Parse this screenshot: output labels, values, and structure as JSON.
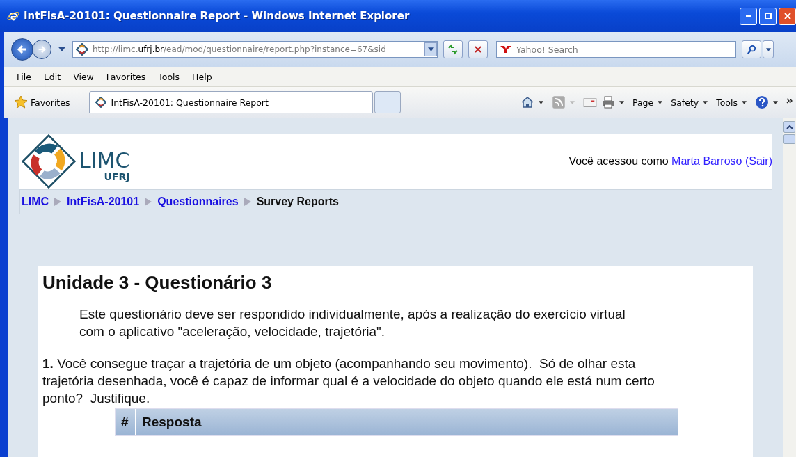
{
  "window": {
    "title": "IntFisA-20101: Questionnaire Report - Windows Internet Explorer"
  },
  "address_bar": {
    "segments": [
      {
        "text": "http://limc.",
        "emphasis": false
      },
      {
        "text": "ufrj.br",
        "emphasis": true
      },
      {
        "text": "/ead/mod/questionnaire/report.php?instance=67&sid",
        "emphasis": false
      }
    ]
  },
  "search": {
    "placeholder": "Yahoo! Search"
  },
  "menu": [
    "File",
    "Edit",
    "View",
    "Favorites",
    "Tools",
    "Help"
  ],
  "favorites_bar": {
    "label": "Favorites",
    "tabs": [
      {
        "label": "IntFisA-20101: Questionnaire Report",
        "selected": true
      }
    ],
    "commands": [
      "Page",
      "Safety",
      "Tools"
    ]
  },
  "page": {
    "logo": {
      "name": "LIMC",
      "sub": "UFRJ"
    },
    "login": {
      "prefix": "Você acessou como",
      "user": "Marta Barroso",
      "open": "(",
      "logout": "Sair",
      "close": ")"
    },
    "breadcrumb": [
      {
        "label": "LIMC",
        "link": true
      },
      {
        "label": "IntFisA-20101",
        "link": true
      },
      {
        "label": "Questionnaires",
        "link": true
      },
      {
        "label": "Survey Reports",
        "link": false
      }
    ],
    "heading": "Unidade 3 - Questionário 3",
    "intro": "Este questionário deve ser respondido individualmente, após a realização do exercício virtual com o aplicativo \"aceleração, velocidade, trajetória\".",
    "question": "**1.** Você consegue traçar a trajetória de um objeto (acompanhando seu movimento).  Só de olhar esta trajetória desenhada, você é capaz de informar qual é a velocidade do objeto quando ele está num certo ponto?  Justifique.",
    "table": {
      "columns": [
        "#",
        "Resposta"
      ]
    }
  }
}
